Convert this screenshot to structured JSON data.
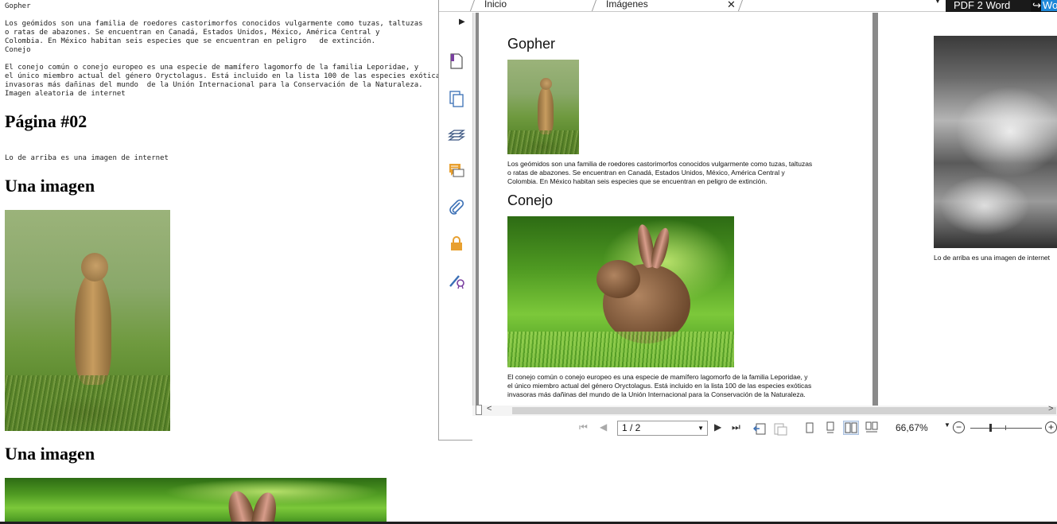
{
  "left_doc": {
    "line_gopher_title": "Gopher",
    "gopher_text": "Los geómidos son una familia de roedores castorimorfos conocidos vulgarmente como tuzas, taltuzas\no ratas de abazones. Se encuentran en Canadá, Estados Unidos, México, América Central y\nColombia. En México habitan seis especies que se encuentran en peligro   de extinción.",
    "line_conejo_title": "Conejo",
    "conejo_text": "El conejo común o conejo europeo es una especie de mamífero lagomorfo de la familia Leporidae, y\nel único miembro actual del género Oryctolagus. Está incluido en la lista 100 de las especies exóticas\ninvasoras más dañinas del mundo  de la Unión Internacional para la Conservación de la Naturaleza.",
    "random_image_line": "Imagen aleatoria de internet",
    "page_heading": "Página #02",
    "internet_note": "Lo de arriba es una imagen de internet",
    "heading_image_1": "Una imagen",
    "heading_image_2": "Una imagen"
  },
  "viewer": {
    "tabs": [
      {
        "label": "Inicio"
      },
      {
        "label": "Imágenes"
      }
    ],
    "tab_close": "✕",
    "menu_arrow": "▼",
    "pdf2word_label": "PDF 2 Word",
    "wo_label": "Wo",
    "pdf_page1": {
      "gopher_heading": "Gopher",
      "gopher_text": "Los geómidos son una familia de roedores castorimorfos conocidos vulgarmente como tuzas, taltuzas\no ratas de abazones. Se encuentran en Canadá, Estados Unidos, México, América Central y\nColombia. En México habitan seis especies que se encuentran en peligro de extinción.",
      "conejo_heading": "Conejo",
      "conejo_text": "El conejo común o conejo europeo es una especie de mamífero lagomorfo de la familia Leporidae, y\nel único miembro actual del género Oryctolagus. Está incluido en la lista 100 de las especies exóticas\ninvasoras más dañinas del mundo de la Unión Internacional para la Conservación de la Naturaleza."
    },
    "pdf_page2": {
      "caption": "Lo de arriba es una imagen de internet"
    },
    "toolbar": {
      "first_page": "⏮",
      "prev_page": "◀",
      "page_value": "1 / 2",
      "next_page": "▶",
      "last_page": "⏭",
      "zoom_value": "66,67%",
      "zoom_out": "−",
      "zoom_in": "+"
    },
    "scroll_left": "<",
    "scroll_right": ">",
    "sidebar_expand": "▶"
  },
  "colors": {
    "pdf2word_bg": "#1a1a1a",
    "accent_blue": "#1e88d8",
    "sidebar_purple": "#7a3fa0",
    "sidebar_blue": "#3a6fb5",
    "sidebar_orange": "#e8a030"
  },
  "icons": [
    "page-icon",
    "pages-icon",
    "layers-icon",
    "comments-icon",
    "attachment-icon",
    "lock-icon",
    "certificate-icon"
  ]
}
